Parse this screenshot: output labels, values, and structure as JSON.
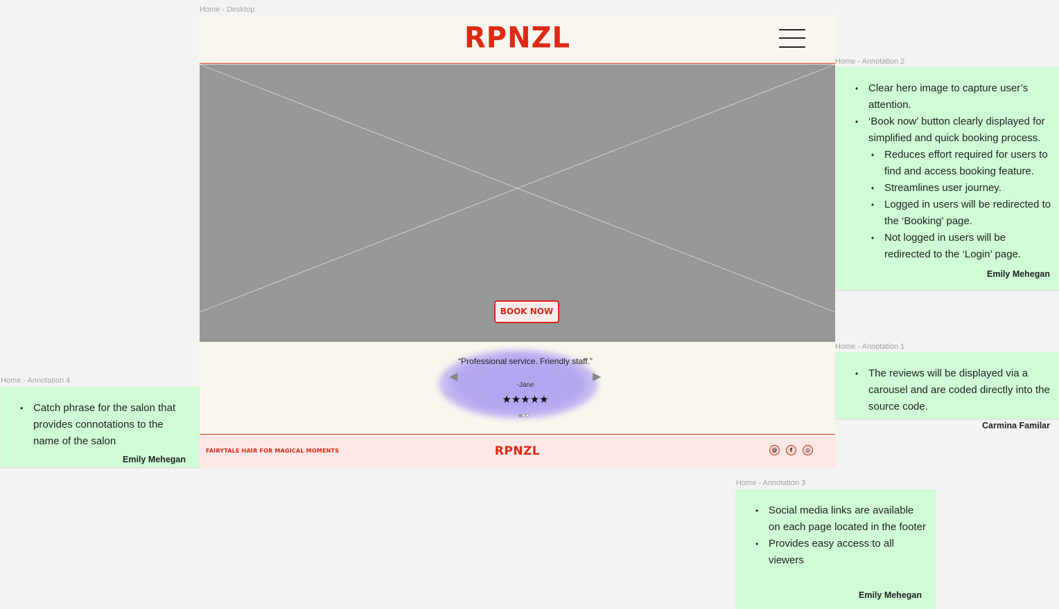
{
  "desktop": {
    "frame_label": "Home - Desktop",
    "logo": "RPNZL",
    "hero": {
      "cta": "BOOK NOW"
    },
    "review": {
      "quote": "“Professional service. Friendly staff.”",
      "author": "-Jane",
      "stars": "★★★★★",
      "rating": 5
    },
    "footer": {
      "tagline": "FAIRYTALE HAIR FOR MAGICAL MOMENTS",
      "logo": "RPNZL",
      "social_icons": [
        "threads-icon",
        "facebook-icon",
        "instagram-icon"
      ]
    }
  },
  "annotations": {
    "a2": {
      "label": "Home - Annotation 2",
      "items": [
        "Clear hero image to capture user’s attention.",
        "‘Book now’ button clearly displayed for simplified and quick booking process.",
        "Reduces effort required for users to find and access booking feature.",
        "Streamlines user journey.",
        "Logged in users will be redirected to the ‘Booking’ page.",
        "Not logged in users will be redirected to the ‘Login’ page."
      ],
      "author": "Emily Mehegan"
    },
    "a1": {
      "label": "Home - Annotation 1",
      "items": [
        "The reviews will be displayed via a carousel and are coded directly into the source code."
      ],
      "author": "Carmina Familar"
    },
    "a4": {
      "label": "Home - Annotation 4",
      "items": [
        "Catch phrase for the salon that provides connotations to the name of the salon"
      ],
      "author": "Emily Mehegan"
    },
    "a3": {
      "label": "Home - Annotation 3",
      "items": [
        "Social media links are available on each page located in the footer",
        "Provides easy access to all viewers"
      ],
      "author": "Emily Mehegan"
    }
  },
  "colors": {
    "brand_red": "#dd2a14",
    "cream": "#f9f6ef",
    "hero_gray": "#979797",
    "note_green": "#cffdd6",
    "footer_pink": "#fde8e6",
    "review_purple": "#b3a4f1"
  }
}
